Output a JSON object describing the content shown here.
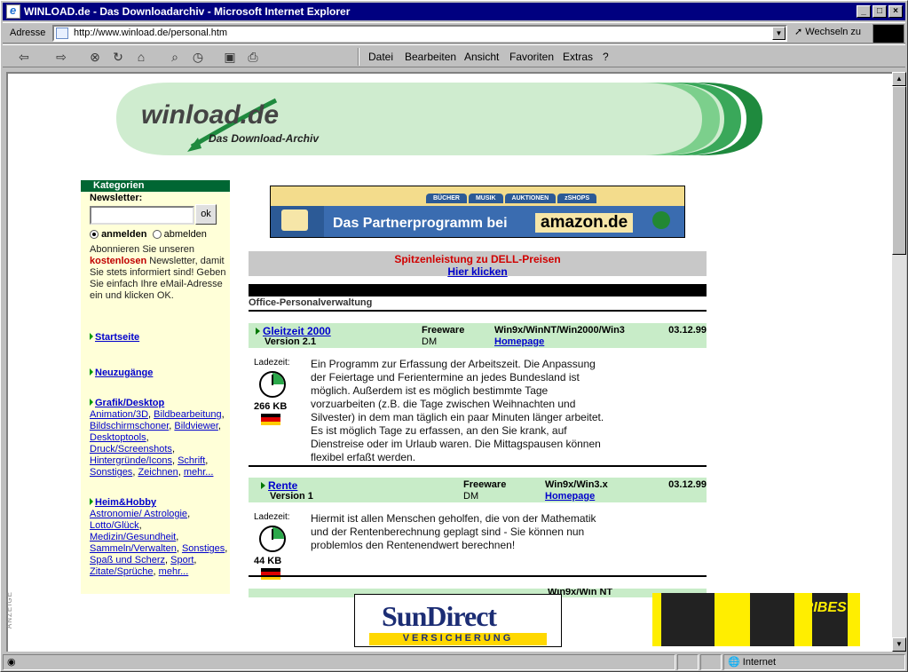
{
  "window": {
    "title": "WINLOAD.de - Das Downloadarchiv - Microsoft Internet Explorer"
  },
  "addressbar": {
    "label": "Adresse",
    "url": "http://www.winload.de/personal.htm",
    "go_label": "Wechseln zu"
  },
  "menu": [
    "Datei",
    "Bearbeiten",
    "Ansicht",
    "Favoriten",
    "Extras",
    "?"
  ],
  "banner": {
    "logo": "winload.de",
    "tagline": "Das Download-Archiv"
  },
  "sidebar": {
    "header": "Kategorien",
    "newsletter_label": "Newsletter:",
    "ok_label": "ok",
    "radio_on": "anmelden",
    "radio_off": "abmelden",
    "desc_1": "Abonnieren Sie unseren",
    "desc_2": "kostenlosen",
    "desc_3": " Newsletter, damit Sie stets informiert sind! Geben Sie einfach Ihre eMail-Adresse ein und klicken OK.",
    "startseite": "Startseite",
    "neuzugaenge": "Neuzugänge",
    "grafik": "Grafik/Desktop",
    "grafik_links": [
      "Animation/3D",
      "Bildbearbeitung",
      "Bildschirmschoner",
      "Bildviewer",
      "Desktoptools",
      "Druck/Screenshots",
      "Hintergründe/Icons",
      "Schrift",
      "Sonstiges",
      "Zeichnen",
      "mehr..."
    ],
    "heim": "Heim&Hobby",
    "heim_links": [
      "Astronomie/ Astrologie",
      "Lotto/Glück",
      "Medizin/Gesundheit",
      "Sammeln/Verwalten",
      "Sonstiges",
      "Spaß und Scherz",
      "Sport",
      "Zitate/Sprüche",
      "mehr..."
    ]
  },
  "amazon_ad": {
    "tabs": [
      "BÜCHER",
      "MUSIK",
      "AUKTIONEN",
      "zSHOPS"
    ],
    "text": "Das Partnerprogramm bei",
    "brand": "amazon.de"
  },
  "dell": {
    "headline": "Spitzenleistung zu DELL-Preisen",
    "link": "Hier klicken"
  },
  "section": "Office-Personalverwaltung",
  "programs": [
    {
      "name": "Gleitzeit 2000",
      "version": "Version 2.1",
      "license": "Freeware",
      "currency": "DM",
      "os": "Win9x/WinNT/Win2000/Win3",
      "homepage": "Homepage",
      "date": "03.12.99",
      "load_label": "Ladezeit:",
      "size": "266 KB",
      "desc": "Ein Programm zur Erfassung der Arbeitszeit. Die Anpassung der Feiertage und Ferientermine an jedes Bundesland ist möglich. Außerdem ist es möglich bestimmte Tage vorzuarbeiten (z.B. die Tage zwischen Weihnachten und Silvester) in dem man täglich ein paar Minuten länger arbeitet. Es ist möglich Tage zu erfassen, an den Sie krank, auf Dienstreise oder im Urlaub waren. Die Mittagspausen können flexibel erfaßt werden."
    },
    {
      "name": "Rente",
      "version": "Version 1",
      "license": "Freeware",
      "currency": "DM",
      "os": "Win9x/Win3.x",
      "homepage": "Homepage",
      "date": "03.12.99",
      "load_label": "Ladezeit:",
      "size": "44 KB",
      "desc": "Hiermit ist allen Menschen geholfen, die von der Mathematik und der Rentenberechnung geplagt sind - Sie können nun problemlos den Rentenendwert berechnen!"
    }
  ],
  "partial_row_os": "Win9x/Win NT",
  "ads": {
    "sun_title": "SunDirect",
    "sun_sub": "VERSICHERUNG",
    "side_label": "ANZEIGE",
    "tribes": "TRIBES"
  },
  "statusbar": {
    "zone": "Internet"
  }
}
